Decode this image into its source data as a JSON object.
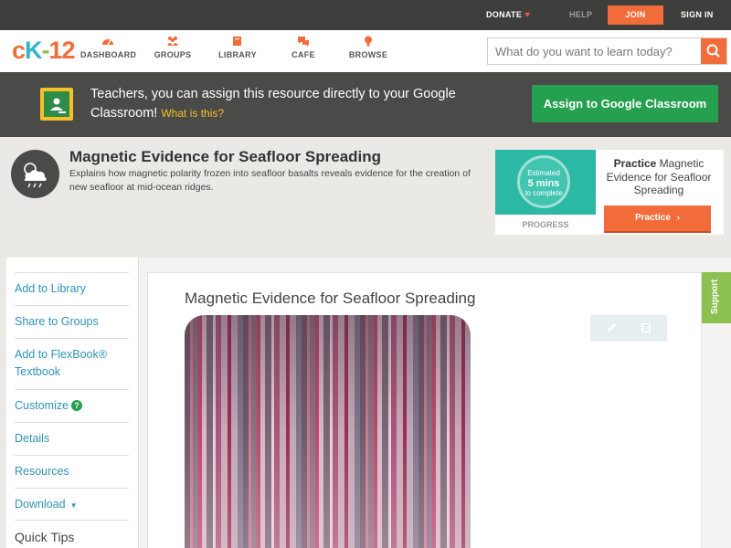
{
  "topbar": {
    "donate": "DONATE",
    "help": "HELP",
    "join": "JOIN",
    "signin": "SIGN IN"
  },
  "header": {
    "logo": {
      "c": "c",
      "k": "K",
      "dash": "-",
      "num": "12"
    },
    "nav": [
      {
        "label": "DASHBOARD",
        "icon": "dashboard-icon"
      },
      {
        "label": "GROUPS",
        "icon": "groups-icon"
      },
      {
        "label": "LIBRARY",
        "icon": "library-icon"
      },
      {
        "label": "CAFE",
        "icon": "cafe-icon"
      },
      {
        "label": "BROWSE",
        "icon": "browse-icon"
      }
    ],
    "search_placeholder": "What do you want to learn today?"
  },
  "classroom_banner": {
    "text": "Teachers, you can assign this resource directly to your Google Classroom!",
    "what_link": "What is this?",
    "assign_button": "Assign to Google Classroom"
  },
  "concept": {
    "title": "Magnetic Evidence for Seafloor Spreading",
    "description": "Explains how magnetic polarity frozen into seafloor basalts reveals evidence for the creation of new seafloor at mid-ocean ridges."
  },
  "practice_card": {
    "estimate_line1": "Estimated",
    "estimate_line2": "5 mins",
    "estimate_line3": "to complete",
    "progress_label": "PROGRESS",
    "title_bold": "Practice",
    "title_rest": "Magnetic Evidence for Seafloor Spreading",
    "button": "Practice"
  },
  "sidebar": {
    "items": [
      "Add to Library",
      "Share to Groups",
      "Add to FlexBook® Textbook",
      "Customize",
      "Details",
      "Resources",
      "Download"
    ],
    "customize_help": "?",
    "quick_tips": "Quick Tips"
  },
  "content": {
    "title": "Magnetic Evidence for Seafloor Spreading"
  },
  "support_tab": "Support",
  "colors": {
    "brand_orange": "#f26b3a",
    "brand_green": "#25a04f",
    "link_blue": "#2f93b8",
    "support_green": "#8cc152"
  }
}
